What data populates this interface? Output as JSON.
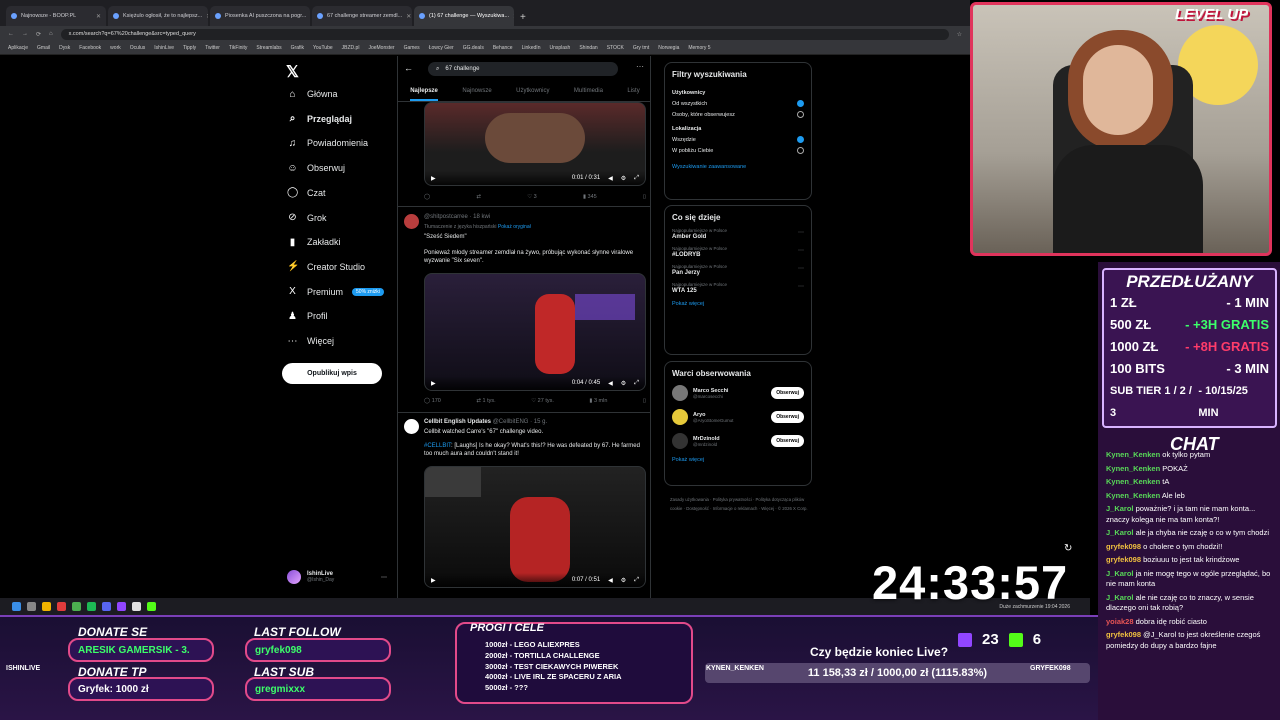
{
  "browser": {
    "tabs": [
      {
        "label": "Najnowsze - BOOP.PL"
      },
      {
        "label": "Księżulo ogłosił, że to najlepsz..."
      },
      {
        "label": "Piosenka AI puszczona na pogr..."
      },
      {
        "label": "67 challenge streamer zemdl..."
      },
      {
        "label": "(1) 67 challenge — Wyszukiwa..."
      }
    ],
    "url": "x.com/search?q=67%20challenge&src=typed_query",
    "bookmarks": [
      "Aplikacje",
      "Gmail",
      "Dysk",
      "Facebook",
      "work",
      "Oculus",
      "IshinLive",
      "Tipply",
      "Twitter",
      "TikFinity",
      "Streamlabs",
      "Grafik",
      "YouTube",
      "JBZD.pl",
      "JoeMonster",
      "Games",
      "Łowcy Gier",
      "GG.deals",
      "Behance",
      "LinkedIn",
      "Unsplash",
      "Shindan",
      "STOCK",
      "Gry tmt",
      "Norwegia",
      "Memory 5"
    ]
  },
  "xnav": {
    "items": [
      {
        "label": "Główna",
        "icon": "home-icon",
        "glyph": "⌂"
      },
      {
        "label": "Przeglądaj",
        "icon": "search-icon",
        "glyph": "⌕"
      },
      {
        "label": "Powiadomienia",
        "icon": "bell-icon",
        "glyph": "♫"
      },
      {
        "label": "Obserwuj",
        "icon": "follow-icon",
        "glyph": "☺"
      },
      {
        "label": "Czat",
        "icon": "chat-icon",
        "glyph": "◯"
      },
      {
        "label": "Grok",
        "icon": "grok-icon",
        "glyph": "⊘"
      },
      {
        "label": "Zakładki",
        "icon": "bookmark-icon",
        "glyph": "▮"
      },
      {
        "label": "Creator Studio",
        "icon": "creator-icon",
        "glyph": "⚡"
      },
      {
        "label": "Premium",
        "icon": "premium-icon",
        "glyph": "X"
      },
      {
        "label": "Profil",
        "icon": "profile-icon",
        "glyph": "♟"
      },
      {
        "label": "Więcej",
        "icon": "more-icon",
        "glyph": "⋯"
      }
    ],
    "premium_badge": "50% zniżki",
    "post_button": "Opublikuj wpis",
    "account_name": "IshinLive",
    "account_handle": "@Ishin_Day"
  },
  "search": {
    "query": "67 challenge",
    "tabs": [
      "Najlepsze",
      "Najnowsze",
      "Użytkownicy",
      "Multimedia",
      "Listy"
    ]
  },
  "posts": [
    {
      "video_time": "0:01 / 0:31",
      "actions": [
        "",
        "",
        "3",
        "345"
      ]
    },
    {
      "author": "@shitpostcarree · 18 kwi",
      "translated": "Tłumaczenie z języka hiszpański",
      "show_original": "Pokaż oryginał",
      "quote": "\"Sześć Siedem\"",
      "text": "Ponieważ młody streamer zemdlał na żywo, próbując wykonać słynne viralowe wyzwanie \"Six seven\".",
      "video_time": "0:04 / 0:45",
      "actions": [
        "170",
        "1 tys.",
        "27 tys.",
        "3 mln"
      ]
    },
    {
      "author_name": "Cellbit English Updates",
      "author": "@CellbitENG · 15 g.",
      "line1": "Cellbit watched Carre's \"67\" challenge video.",
      "hashtag": "#CELLBIT",
      "text": ": [Laughs] Is he okay? What's this!? He was defeated by 67. He farmed too much aura and couldn't stand it!",
      "video_time": "0:07 / 0:51"
    }
  ],
  "filters": {
    "title": "Filtry wyszukiwania",
    "users_label": "Użytkownicy",
    "users_options": [
      "Od wszystkich",
      "Osoby, które obserwujesz"
    ],
    "location_label": "Lokalizacja",
    "location_options": [
      "Wszędzie",
      "W pobliżu Ciebie"
    ],
    "advanced": "Wyszukiwanie zaawansowane"
  },
  "trends": {
    "title": "Co się dzieje",
    "items": [
      {
        "context": "Najpopularniejsze w Polsce",
        "name": "Amber Gold"
      },
      {
        "context": "Najpopularniejsze w Polsce",
        "name": "#LODRYB"
      },
      {
        "context": "Najpopularniejsze w Polsce",
        "name": "Pan Jerzy"
      },
      {
        "context": "Najpopularniejsze w Polsce",
        "name": "WTA 125"
      }
    ],
    "show_more": "Pokaż więcej"
  },
  "who_to_follow": {
    "title": "Warci obserwowania",
    "items": [
      {
        "name": "Marco Secchi",
        "handle": "@marcosecchi",
        "btn": "Obserwuj"
      },
      {
        "name": "Aryo",
        "handle": "@AryoStomeGumut",
        "btn": "Obserwuj"
      },
      {
        "name": "MrDzinold",
        "handle": "@mrdzinold",
        "btn": "Obserwuj"
      }
    ],
    "show_more": "Pokaż więcej"
  },
  "footer": "Zasady użytkowania · Polityka prywatności · Polityka dotycząca plików cookie · Dostępność · Informacje o reklamach · Więcej · © 2026 X Corp.",
  "taskbar": {
    "tray": "Duże zachmurzenie   19:04 2026"
  },
  "stream": {
    "timer": "24:33:57",
    "level_up": "LEVEL UP",
    "extend_title": "PRZEDŁUŻANY",
    "extend_rows": [
      {
        "l": "1 ZŁ",
        "r": "- 1 MIN",
        "cls": ""
      },
      {
        "l": "500 ZŁ",
        "r": "- +3H GRATIS",
        "cls": "g"
      },
      {
        "l": "1000 ZŁ",
        "r": "- +8H GRATIS",
        "cls": "r"
      },
      {
        "l": "100 BITS",
        "r": "- 3 MIN",
        "cls": ""
      },
      {
        "l": "SUB TIER 1 / 2 / 3",
        "r": "- 10/15/25 MIN",
        "cls": ""
      }
    ],
    "chat_title": "CHAT",
    "chat": [
      {
        "user": "Kynen_Kenken",
        "msg": "ok tylko pytam",
        "cls": "u"
      },
      {
        "user": "Kynen_Kenken",
        "msg": "POKAŻ",
        "cls": "u"
      },
      {
        "user": "Kynen_Kenken",
        "msg": "tA",
        "cls": "u"
      },
      {
        "user": "Kynen_Kenken",
        "msg": "Ale leb",
        "cls": "u"
      },
      {
        "user": "J_Karol",
        "msg": "poważnie? i ja tam nie mam konta... znaczy kolega nie ma tam konta?!",
        "cls": "u"
      },
      {
        "user": "J_Karol",
        "msg": "ale ja chyba nie czaję o co w tym chodzi",
        "cls": "u"
      },
      {
        "user": "gryfek098",
        "msg": "o cholere o tym chodzi!!",
        "cls": "u3"
      },
      {
        "user": "gryfek098",
        "msg": "boziuuu to jest tak krindżowe",
        "cls": "u3"
      },
      {
        "user": "J_Karol",
        "msg": "ja nie mogę tego w ogóle przeglądać, bo nie mam konta",
        "cls": "u"
      },
      {
        "user": "J_Karol",
        "msg": "ale nie czaję co to znaczy, w sensie dlaczego oni tak robią?",
        "cls": "u"
      },
      {
        "user": "yoiak28",
        "msg": "dobra idę robić ciasto",
        "cls": "u2"
      },
      {
        "user": "gryfek098",
        "msg": "@J_Karol to jest określenie czegoś pomiedzy do dupy a bardzo fajne",
        "cls": "u3"
      }
    ],
    "donate_label": "DONATE SE",
    "donate_value": "ARESIK GAMERSIK - 3.",
    "donate_tp_label": "DONATE TP",
    "donate_tp_value": "Gryfek: 1000 zł",
    "last_follow_label": "LAST FOLLOW",
    "last_follow_value": "gryfek098",
    "last_sub_label": "LAST SUB",
    "last_sub_value": "gregmixxx",
    "goals_title": "PROGI I CELE",
    "goals": [
      "1000zł - LEGO ALIEXPRES",
      "2000zł - TORTILLA CHALLENGE",
      "3000zł - TEST CIEKAWYCH PIWEREK",
      "4000zł - LIVE IRL ZE SPACERU Z ARIA",
      "5000zł - ???"
    ],
    "question": "Czy będzie koniec Live?",
    "progress": "11 158,33 zł / 1000,00 zł (1115.83%)",
    "viewers_twitch": "23",
    "viewers_kick": "6",
    "name_left": "ISHINLIVE",
    "name_mid": "KYNEN_KENKEN",
    "name_right": "GRYFEK098"
  }
}
